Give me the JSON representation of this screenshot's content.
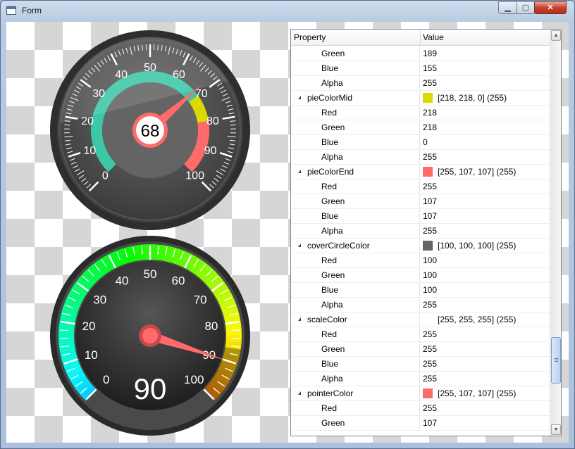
{
  "window": {
    "title": "Form",
    "controls": {
      "minimize": "▁",
      "maximize": "▢",
      "close": "✕"
    }
  },
  "gauge1": {
    "value_text": "68",
    "value": 68,
    "min": 0,
    "max": 100,
    "scale_labels": [
      "0",
      "10",
      "20",
      "30",
      "40",
      "50",
      "60",
      "70",
      "80",
      "90",
      "100"
    ],
    "colors": {
      "pie_start": "#3cc8a8",
      "pie_mid": "#dada00",
      "pie_end": "#ff6b6b",
      "cover": "#646464",
      "scale": "#ffffff",
      "pointer": "#ff6b6b"
    }
  },
  "gauge2": {
    "value_text": "90",
    "value": 90,
    "min": 0,
    "max": 100,
    "scale_labels": [
      "0",
      "10",
      "20",
      "30",
      "40",
      "50",
      "60",
      "70",
      "80",
      "90",
      "100"
    ],
    "colors": {
      "pointer": "#ff6b6b",
      "scale": "#ffffff"
    }
  },
  "property_grid": {
    "headers": {
      "property": "Property",
      "value": "Value"
    },
    "rows": [
      {
        "level": 1,
        "name": "Green",
        "value": "189"
      },
      {
        "level": 1,
        "name": "Blue",
        "value": "155"
      },
      {
        "level": 1,
        "name": "Alpha",
        "value": "255"
      },
      {
        "level": 0,
        "name": "pieColorMid",
        "value": "[218, 218, 0] (255)",
        "color": "#dada00"
      },
      {
        "level": 1,
        "name": "Red",
        "value": "218"
      },
      {
        "level": 1,
        "name": "Green",
        "value": "218"
      },
      {
        "level": 1,
        "name": "Blue",
        "value": "0"
      },
      {
        "level": 1,
        "name": "Alpha",
        "value": "255"
      },
      {
        "level": 0,
        "name": "pieColorEnd",
        "value": "[255, 107, 107] (255)",
        "color": "#ff6b6b"
      },
      {
        "level": 1,
        "name": "Red",
        "value": "255"
      },
      {
        "level": 1,
        "name": "Green",
        "value": "107"
      },
      {
        "level": 1,
        "name": "Blue",
        "value": "107"
      },
      {
        "level": 1,
        "name": "Alpha",
        "value": "255"
      },
      {
        "level": 0,
        "name": "coverCircleColor",
        "value": "[100, 100, 100] (255)",
        "color": "#646464"
      },
      {
        "level": 1,
        "name": "Red",
        "value": "100"
      },
      {
        "level": 1,
        "name": "Green",
        "value": "100"
      },
      {
        "level": 1,
        "name": "Blue",
        "value": "100"
      },
      {
        "level": 1,
        "name": "Alpha",
        "value": "255"
      },
      {
        "level": 0,
        "name": "scaleColor",
        "value": "[255, 255, 255] (255)",
        "color": "#ffffff"
      },
      {
        "level": 1,
        "name": "Red",
        "value": "255"
      },
      {
        "level": 1,
        "name": "Green",
        "value": "255"
      },
      {
        "level": 1,
        "name": "Blue",
        "value": "255"
      },
      {
        "level": 1,
        "name": "Alpha",
        "value": "255"
      },
      {
        "level": 0,
        "name": "pointerColor",
        "value": "[255, 107, 107] (255)",
        "color": "#ff6b6b"
      },
      {
        "level": 1,
        "name": "Red",
        "value": "255"
      },
      {
        "level": 1,
        "name": "Green",
        "value": "107"
      }
    ]
  }
}
